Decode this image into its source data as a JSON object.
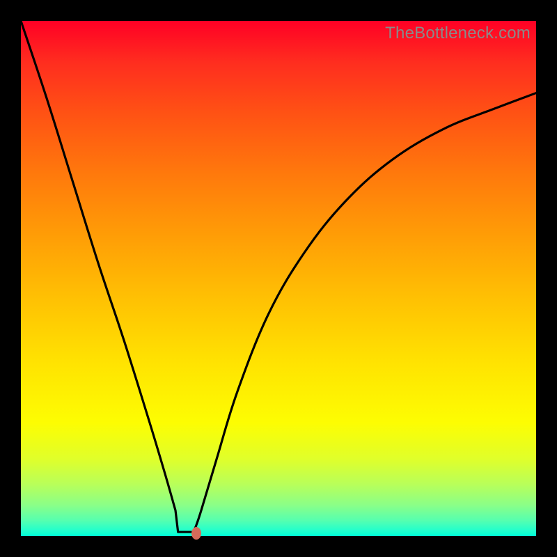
{
  "watermark": "TheBottleneck.com",
  "chart_data": {
    "type": "line",
    "title": "",
    "xlabel": "",
    "ylabel": "",
    "xlim": [
      0,
      100
    ],
    "ylim": [
      0,
      100
    ],
    "series": [
      {
        "name": "bottleneck-curve",
        "x": [
          0,
          5,
          10,
          15,
          20,
          25,
          28,
          30,
          31,
          32,
          33,
          34,
          35,
          38,
          42,
          48,
          55,
          63,
          72,
          82,
          92,
          100
        ],
        "y": [
          100,
          85,
          69,
          53,
          38,
          22,
          12,
          5,
          2,
          1,
          1,
          2,
          5,
          15,
          28,
          43,
          55,
          65,
          73,
          79,
          83,
          86
        ]
      }
    ],
    "flat_segment": {
      "x_start": 30.5,
      "x_end": 33.5,
      "y": 0.8
    },
    "marker": {
      "x": 34,
      "y": 0.5,
      "color": "#d56a5a"
    },
    "gradient_stops": [
      {
        "pos": 0,
        "color": "#ff0025"
      },
      {
        "pos": 50,
        "color": "#ffcc00"
      },
      {
        "pos": 78,
        "color": "#fdfd02"
      },
      {
        "pos": 100,
        "color": "#00ffd6"
      }
    ]
  }
}
